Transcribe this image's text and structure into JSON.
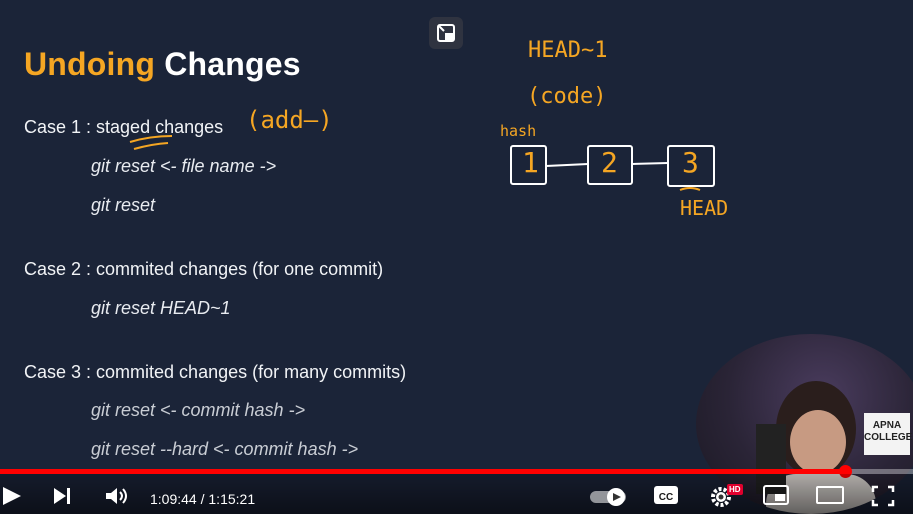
{
  "slide": {
    "title_accent": "Undoing",
    "title_rest": "Changes",
    "case1": "Case 1 : staged changes",
    "case1_cmd1": "git reset <- file name ->",
    "case1_cmd2": "git reset",
    "case2": "Case 2 : commited changes (for one commit)",
    "case2_cmd1": "git reset HEAD~1",
    "case3": "Case 3 : commited changes (for many commits)",
    "case3_cmd1": "git reset <- commit hash ->",
    "case3_cmd2": "git reset --hard <- commit hash ->"
  },
  "annotations": {
    "add": "(add—)",
    "head_tilde": "HEAD~1",
    "code": "(code)",
    "hash": "hash",
    "commit1": "1",
    "commit2": "2",
    "commit3": "3",
    "head": "HEAD"
  },
  "logo": {
    "text_line1": "APNA",
    "text_line2": "COLLEGE"
  },
  "player": {
    "time_current": "1:09:44",
    "time_separator": " / ",
    "time_total": "1:15:21",
    "progress": 0.925,
    "hd_badge": "HD",
    "accent_color": "#ff0000"
  },
  "icons": {
    "pip_toggle": "picture-in-picture-icon",
    "play": "play-icon",
    "next": "next-icon",
    "volume": "volume-icon",
    "autoplay": "autoplay-toggle-icon",
    "captions": "captions-icon",
    "settings": "gear-icon",
    "miniplayer": "miniplayer-icon",
    "theater": "theater-mode-icon",
    "fullscreen": "fullscreen-icon"
  }
}
